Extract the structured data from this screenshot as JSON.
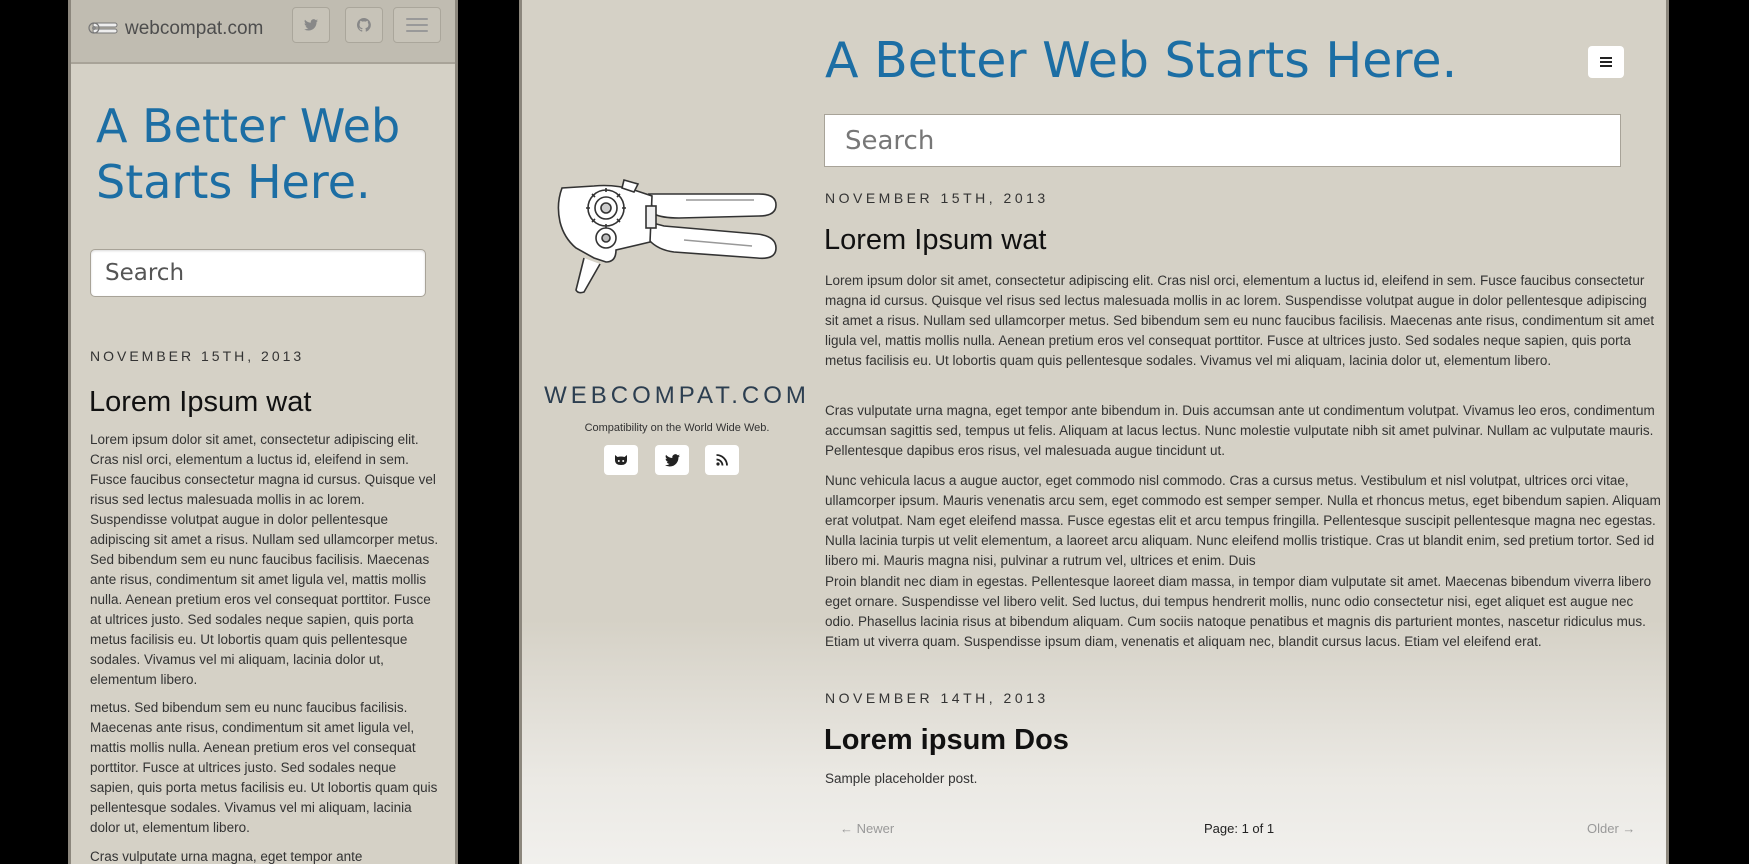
{
  "mobile": {
    "brand": "webcompat.com",
    "title": "A Better Web Starts Here.",
    "search_placeholder": "Search",
    "post": {
      "date": "NOVEMBER 15TH, 2013",
      "title": "Lorem Ipsum wat",
      "paragraphs": [
        "Lorem ipsum dolor sit amet, consectetur adipiscing elit. Cras nisl orci, elementum a luctus id, eleifend in sem. Fusce faucibus consectetur magna id cursus. Quisque vel risus sed lectus malesuada mollis in ac lorem. Suspendisse volutpat augue in dolor pellentesque adipiscing sit amet a risus. Nullam sed ullamcorper metus. Sed bibendum sem eu nunc faucibus facilisis. Maecenas ante risus, condimentum sit amet ligula vel, mattis mollis nulla. Aenean pretium eros vel consequat porttitor. Fusce at ultrices justo. Sed sodales neque sapien, quis porta metus facilisis eu. Ut lobortis quam quis pellentesque sodales. Vivamus vel mi aliquam, lacinia dolor ut, elementum libero.",
        "metus. Sed bibendum sem eu nunc faucibus facilisis. Maecenas ante risus, condimentum sit amet ligula vel, mattis mollis nulla. Aenean pretium eros vel consequat porttitor. Fusce at ultrices justo. Sed sodales neque sapien, quis porta metus facilisis eu. Ut lobortis quam quis pellentesque sodales. Vivamus vel mi aliquam, lacinia dolor ut, elementum libero.",
        "Cras vulputate urna magna, eget tempor ante"
      ]
    }
  },
  "desktop": {
    "title": "A Better Web Starts Here.",
    "search_placeholder": "Search",
    "brand": "WEBCOMPAT.COM",
    "tagline": "Compatibility on the World Wide Web.",
    "posts": [
      {
        "date": "NOVEMBER 15TH, 2013",
        "title": "Lorem Ipsum wat",
        "paragraphs": [
          "Lorem ipsum dolor sit amet, consectetur adipiscing elit. Cras nisl orci, elementum a luctus id, eleifend in sem. Fusce faucibus consectetur magna id cursus. Quisque vel risus sed lectus malesuada mollis in ac lorem. Suspendisse volutpat augue in dolor pellentesque adipiscing sit amet a risus. Nullam sed ullamcorper metus. Sed bibendum sem eu nunc faucibus facilisis. Maecenas ante risus, condimentum sit amet ligula vel, mattis mollis nulla. Aenean pretium eros vel consequat porttitor. Fusce at ultrices justo. Sed sodales neque sapien, quis porta metus facilisis eu. Ut lobortis quam quis pellentesque sodales. Vivamus vel mi aliquam, lacinia dolor ut, elementum libero.",
          "Cras vulputate urna magna, eget tempor ante bibendum in. Duis accumsan ante ut condimentum volutpat. Vivamus leo eros, condimentum accumsan sagittis sed, tempus ut felis. Aliquam at lacus lectus. Nunc molestie vulputate nibh sit amet pulvinar. Nullam ac vulputate mauris. Pellentesque dapibus eros risus, vel malesuada augue tincidunt ut.",
          "Nunc vehicula lacus a augue auctor, eget commodo nisl commodo. Cras a cursus metus. Vestibulum et nisl volutpat, ultrices orci vitae, ullamcorper ipsum. Mauris venenatis arcu sem, eget commodo est semper semper. Nulla et rhoncus metus, eget bibendum sapien. Aliquam erat volutpat. Nam eget eleifend massa. Fusce egestas elit et arcu tempus fringilla. Pellentesque suscipit pellentesque magna nec egestas. Nulla lacinia turpis ut velit elementum, a laoreet arcu aliquam. Nunc eleifend mollis tristique. Cras ut blandit enim, sed pretium tortor. Sed id libero mi. Mauris magna nisi, pulvinar a rutrum vel, ultrices et enim. Duis",
          "Proin blandit nec diam in egestas. Pellentesque laoreet diam massa, in tempor diam vulputate sit amet. Maecenas bibendum viverra libero eget ornare. Suspendisse vel libero velit. Sed luctus, dui tempus hendrerit mollis, nunc odio consectetur nisi, eget aliquet est augue nec odio. Phasellus lacinia risus at bibendum aliquam. Cum sociis natoque penatibus et magnis dis parturient montes, nascetur ridiculus mus. Etiam ut viverra quam. Suspendisse ipsum diam, venenatis et aliquam nec, blandit cursus lacus. Etiam vel eleifend erat."
        ]
      },
      {
        "date": "NOVEMBER 14TH, 2013",
        "title": "Lorem ipsum Dos",
        "paragraphs": [
          "Sample placeholder post."
        ]
      }
    ],
    "pagination": {
      "newer": "← Newer",
      "page": "Page: 1 of 1",
      "older": "Older →"
    }
  },
  "colors": {
    "accent": "#1c6ea4",
    "background": "#d5d1c6",
    "text": "#333333"
  },
  "icons": [
    "logo-icon",
    "twitter-icon",
    "github-icon",
    "hamburger-icon",
    "rss-icon"
  ]
}
